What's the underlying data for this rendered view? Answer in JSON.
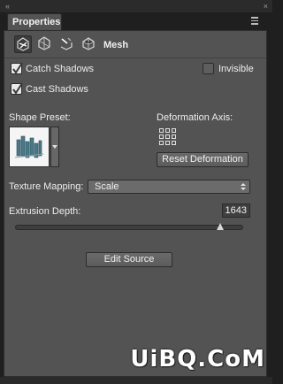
{
  "panel": {
    "tab_label": "Properties",
    "top_left_glyph": "«",
    "top_right_glyph": "×"
  },
  "modes": {
    "active": "mesh",
    "icons": [
      "mesh-icon",
      "deform-icon",
      "cap-icon",
      "coordinates-icon"
    ],
    "label": "Mesh"
  },
  "options": {
    "catch_shadows": {
      "label": "Catch Shadows",
      "checked": true
    },
    "invisible": {
      "label": "Invisible",
      "checked": false
    },
    "cast_shadows": {
      "label": "Cast Shadows",
      "checked": true
    }
  },
  "shape_preset": {
    "label": "Shape Preset:"
  },
  "deformation": {
    "label": "Deformation Axis:",
    "reset_label": "Reset Deformation"
  },
  "texture_mapping": {
    "label": "Texture Mapping:",
    "value": "Scale"
  },
  "extrusion": {
    "label": "Extrusion Depth:",
    "value": "1643",
    "slider_fraction": 0.9
  },
  "actions": {
    "edit_source_label": "Edit Source"
  },
  "watermark": {
    "text": "UiBQ.CoM"
  }
}
